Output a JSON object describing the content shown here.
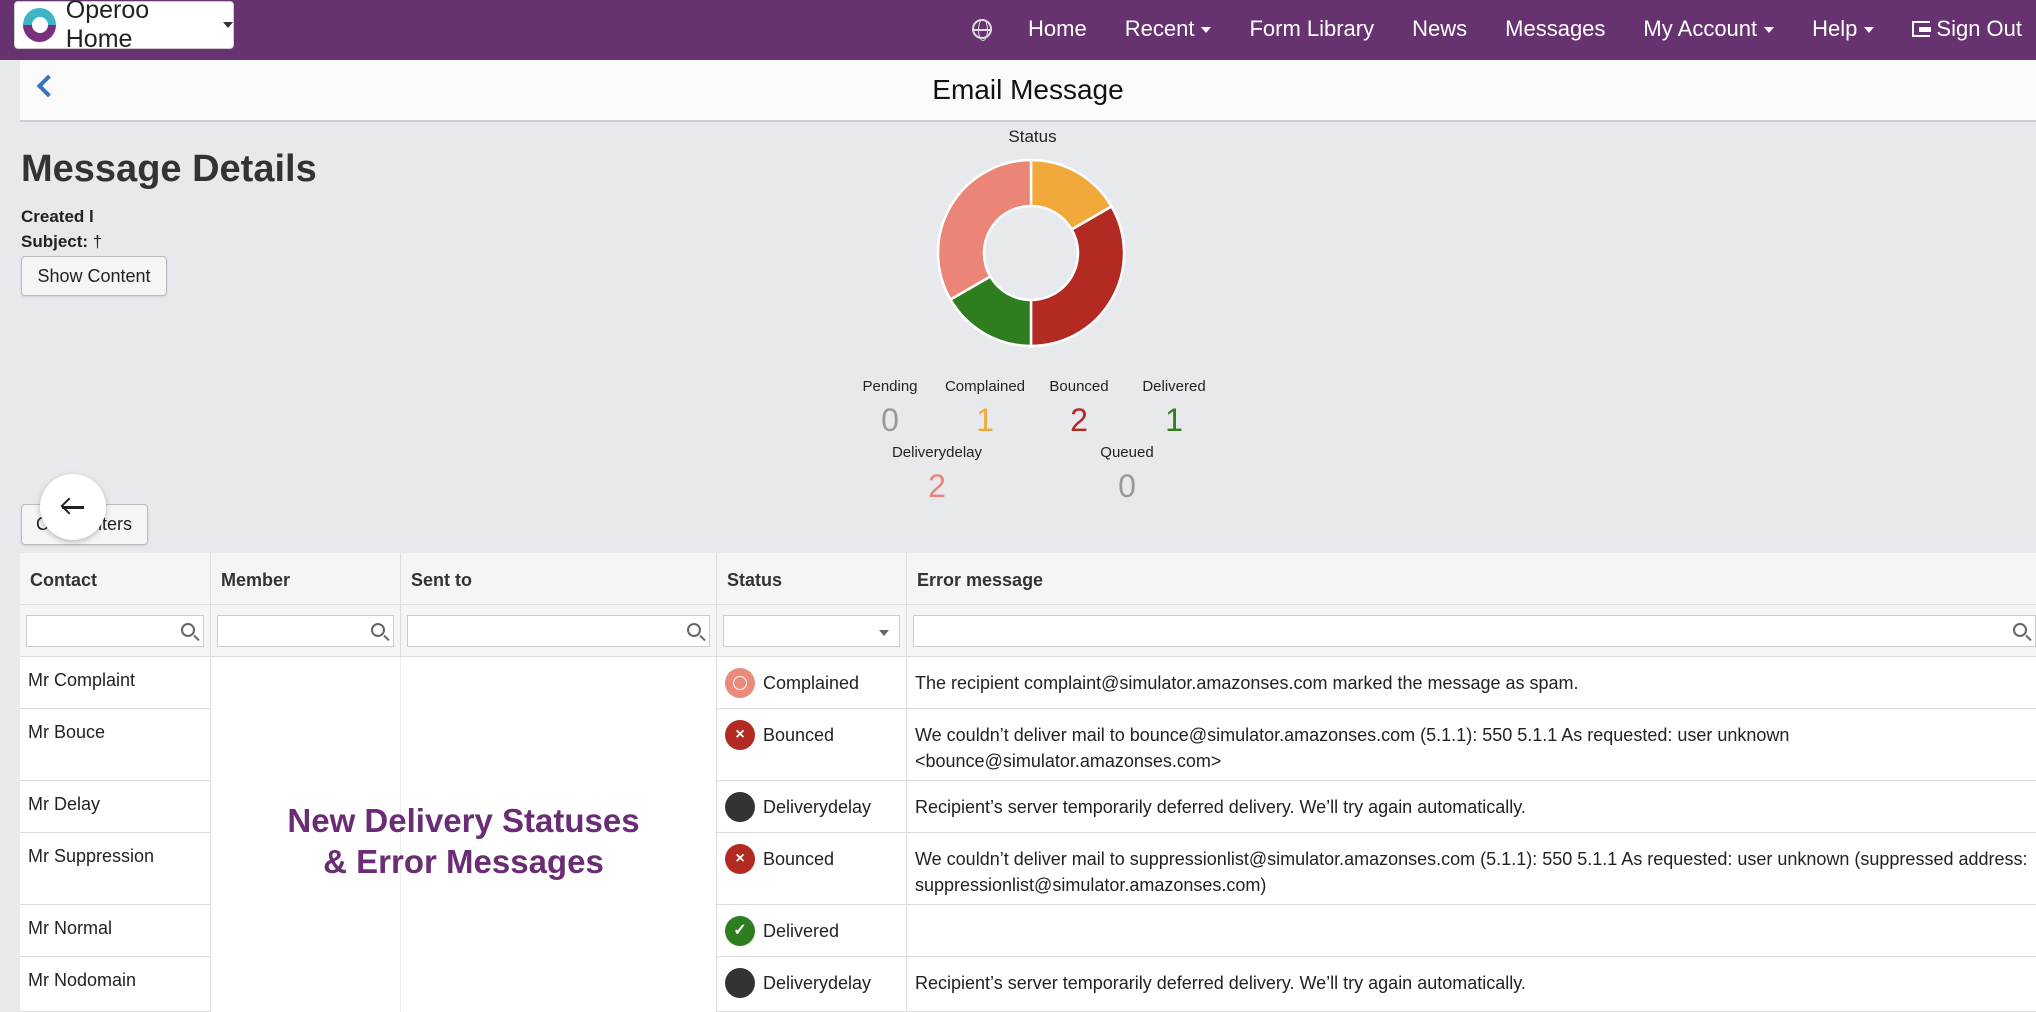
{
  "navbar": {
    "brand": "Operoo Home",
    "items": [
      "Home",
      "Recent",
      "Form Library",
      "News",
      "Messages",
      "My Account",
      "Help",
      "Sign Out"
    ],
    "color": "#663370"
  },
  "header": {
    "title": "Email Message"
  },
  "details": {
    "title": "Message Details",
    "created_label": "Created l",
    "subject_label": "Subject:",
    "subject_value": "†",
    "show_content": "Show Content",
    "filters_button": "C         ilters"
  },
  "chart_data": {
    "type": "pie",
    "title": "Status",
    "categories": [
      "Pending",
      "Complained",
      "Bounced",
      "Delivered",
      "Deliverydelay",
      "Queued"
    ],
    "values": [
      0,
      1,
      2,
      1,
      2,
      0
    ],
    "colors": [
      "#999999",
      "#f2a93b",
      "#b22a22",
      "#2e7d1f",
      "#ea8577",
      "#999999"
    ]
  },
  "table": {
    "headers": [
      "Contact",
      "Member",
      "Sent to",
      "Status",
      "Error message"
    ],
    "rows": [
      {
        "contact": "Mr Complaint",
        "status": "Complained",
        "icon": "complained",
        "error": "The recipient complaint@simulator.amazonses.com marked the message as spam."
      },
      {
        "contact": "Mr Bouce",
        "status": "Bounced",
        "icon": "bounced",
        "error": "We couldn’t deliver mail to bounce@simulator.amazonses.com (5.1.1): 550 5.1.1 As requested: user unknown\n<bounce@simulator.amazonses.com>"
      },
      {
        "contact": "Mr Delay",
        "status": "Deliverydelay",
        "icon": "delay",
        "error": "Recipient’s server temporarily deferred delivery. We’ll try again automatically."
      },
      {
        "contact": "Mr Suppression",
        "status": "Bounced",
        "icon": "bounced",
        "error": "We couldn’t deliver mail to suppressionlist@simulator.amazonses.com (5.1.1): 550 5.1.1 As requested: user unknown (suppressed address:\nsuppressionlist@simulator.amazonses.com)"
      },
      {
        "contact": "Mr Normal",
        "status": "Delivered",
        "icon": "delivered",
        "error": ""
      },
      {
        "contact": "Mr Nodomain",
        "status": "Deliverydelay",
        "icon": "delay",
        "error": "Recipient’s server temporarily deferred delivery. We’ll try again automatically."
      }
    ]
  },
  "overlay": {
    "line1": "New Delivery Statuses",
    "line2": "& Error Messages"
  }
}
